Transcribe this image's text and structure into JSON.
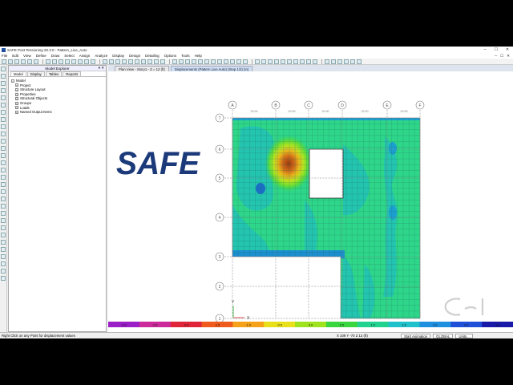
{
  "window": {
    "title": "SAFE Post Tensioning 20.3.0 - Pattern_Live_Auto",
    "controls": [
      "─",
      "☐",
      "✕"
    ]
  },
  "menu": {
    "items": [
      "File",
      "Edit",
      "View",
      "Define",
      "Draw",
      "Select",
      "Assign",
      "Analyze",
      "Display",
      "Design",
      "Detailing",
      "Options",
      "Tools",
      "Help"
    ],
    "right": [
      "─",
      "☐",
      "✕"
    ]
  },
  "explorer": {
    "title": "Model Explorer",
    "header_buttons": "▾ ✕",
    "tabs": [
      "Model",
      "Display",
      "Tables",
      "Reports"
    ],
    "tree_root": "Model",
    "tree_children": [
      "Project",
      "Structure Layout",
      "Properties",
      "Structural Objects",
      "Groups",
      "Loads",
      "Named Output Items"
    ]
  },
  "doc_tabs": [
    "Plan View - Story1 - Z = 12 (ft)",
    "Displacements (Pattern Live Auto) (Step 1/2) (in)"
  ],
  "logo": {
    "text": "SAFE",
    "color": "#1c3a7a"
  },
  "grid": {
    "columns": [
      "A",
      "B",
      "C",
      "D",
      "E",
      "F"
    ],
    "rows": [
      "7",
      "6",
      "5",
      "4",
      "3",
      "2",
      "1"
    ],
    "dimensions": [
      "20.00",
      "20.00",
      "20.00",
      "22.00",
      "20.00"
    ]
  },
  "colorbar": {
    "labels": [
      "-3.0",
      "-2.5",
      "-2.0",
      "-1.5",
      "-1.0",
      "-0.5",
      "0.0",
      "0.5",
      "1.0",
      "1.5",
      "2.0",
      "2.5",
      "3.0"
    ],
    "colors": [
      "#9b1fc6",
      "#cc2a9a",
      "#e0243a",
      "#ef5b1c",
      "#f5a21a",
      "#e8e01a",
      "#9fe31e",
      "#3ad640",
      "#22d38f",
      "#1fc2cc",
      "#1f8fe0",
      "#2050d8",
      "#1a1aa8"
    ]
  },
  "status": {
    "message": "Right Click on any Point for displacement values",
    "coords": "X 109  Y -70  Z 12 (ft)",
    "animation_button": "Start Animation",
    "coord_system": "GLOBAL",
    "units": "Units..."
  },
  "axes_labels": {
    "x": "X",
    "y": "Y"
  }
}
